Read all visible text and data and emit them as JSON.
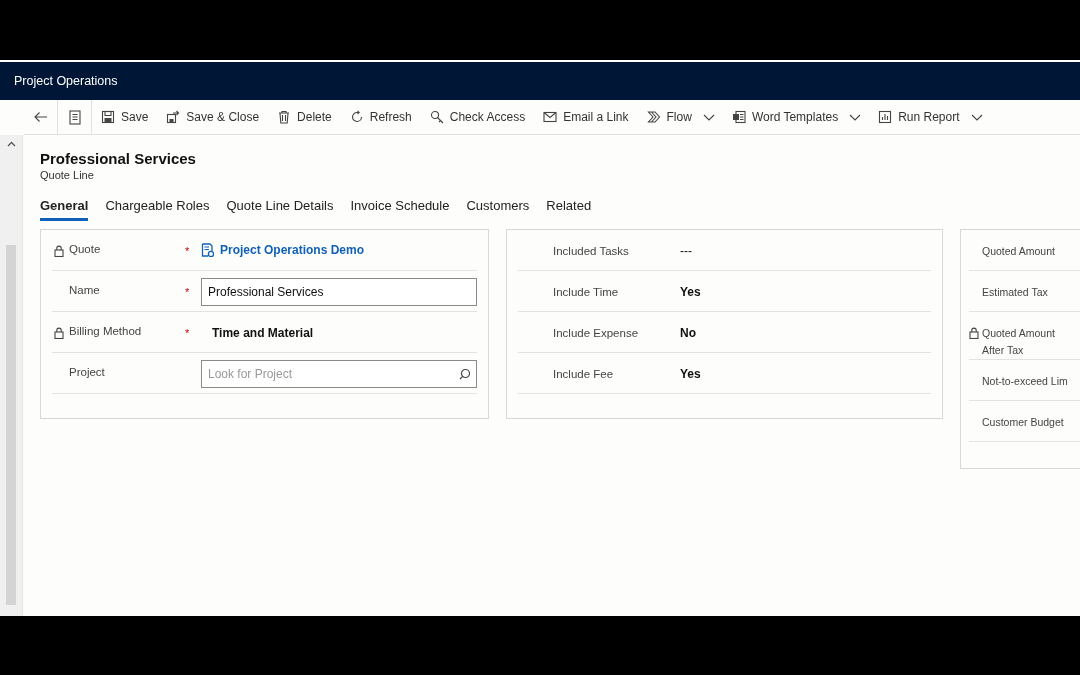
{
  "app_header": {
    "title": "Project Operations"
  },
  "toolbar": {
    "items": [
      {
        "label": "Save",
        "dropdown": false
      },
      {
        "label": "Save & Close",
        "dropdown": false
      },
      {
        "label": "Delete",
        "dropdown": false
      },
      {
        "label": "Refresh",
        "dropdown": false
      },
      {
        "label": "Check Access",
        "dropdown": false
      },
      {
        "label": "Email a Link",
        "dropdown": false
      },
      {
        "label": "Flow",
        "dropdown": true
      },
      {
        "label": "Word Templates",
        "dropdown": true
      },
      {
        "label": "Run Report",
        "dropdown": true
      }
    ]
  },
  "record": {
    "title": "Professional Services",
    "entity": "Quote Line"
  },
  "tabs": [
    {
      "label": "General",
      "selected": true
    },
    {
      "label": "Chargeable Roles",
      "selected": false
    },
    {
      "label": "Quote Line Details",
      "selected": false
    },
    {
      "label": "Invoice Schedule",
      "selected": false
    },
    {
      "label": "Customers",
      "selected": false
    },
    {
      "label": "Related",
      "selected": false
    }
  ],
  "sections": [
    {
      "fields": [
        {
          "label": "Quote",
          "locked": true,
          "required_mark": "*",
          "kind": "link",
          "value": "Project Operations Demo"
        },
        {
          "label": "Name",
          "locked": false,
          "required_mark": "*",
          "kind": "input",
          "value": "Professional Services"
        },
        {
          "label": "Billing Method",
          "locked": true,
          "required_mark": "*",
          "kind": "bold",
          "value": "Time and Material"
        },
        {
          "label": "Project",
          "locked": false,
          "kind": "lookup",
          "placeholder": "Look for Project"
        }
      ]
    },
    {
      "fields": [
        {
          "label": "Included Tasks",
          "locked": false,
          "kind": "text",
          "value": "---"
        },
        {
          "label": "Include Time",
          "locked": false,
          "kind": "bold",
          "value": "Yes"
        },
        {
          "label": "Include Expense",
          "locked": false,
          "kind": "bold",
          "value": "No"
        },
        {
          "label": "Include Fee",
          "locked": false,
          "kind": "bold",
          "value": "Yes"
        }
      ]
    },
    {
      "fields": [
        {
          "label": "Quoted Amount",
          "locked": false,
          "kind": "empty"
        },
        {
          "label": "Estimated Tax",
          "locked": false,
          "kind": "empty"
        },
        {
          "label": "Quoted Amount After Tax",
          "locked": true,
          "kind": "empty"
        },
        {
          "label": "Not-to-exceed Lim",
          "locked": false,
          "kind": "empty"
        },
        {
          "label": "Customer Budget",
          "locked": false,
          "kind": "empty"
        }
      ]
    }
  ]
}
